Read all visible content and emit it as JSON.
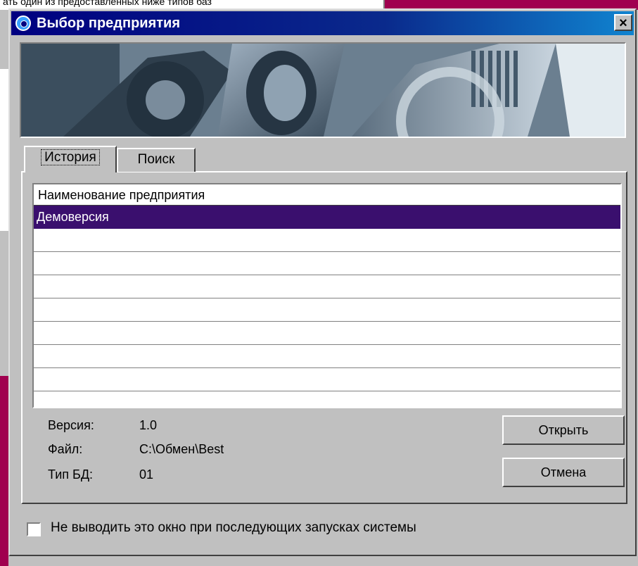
{
  "background": {
    "window_text": "ать один из предоставленных ниже типов баз"
  },
  "dialog": {
    "title": "Выбор предприятия",
    "close_label": "×"
  },
  "tabs": [
    {
      "label": "История",
      "active": true
    },
    {
      "label": "Поиск",
      "active": false
    }
  ],
  "list": {
    "header": "Наименование предприятия",
    "rows": [
      {
        "label": "Демоверсия",
        "selected": true
      },
      {
        "label": ""
      },
      {
        "label": ""
      },
      {
        "label": ""
      },
      {
        "label": ""
      },
      {
        "label": ""
      },
      {
        "label": ""
      },
      {
        "label": ""
      }
    ]
  },
  "info": {
    "version_label": "Версия:",
    "version_value": "1.0",
    "file_label": "Файл:",
    "file_value": "C:\\Обмен\\Best",
    "dbtype_label": "Тип БД:",
    "dbtype_value": "01"
  },
  "buttons": {
    "open": "Открыть",
    "cancel": "Отмена"
  },
  "checkbox": {
    "label": "Не выводить это окно при последующих запусках системы",
    "checked": false
  },
  "colors": {
    "titlebar": "#000080",
    "selection": "#3a0f6e",
    "background_window": "#a0004f"
  },
  "icons": {
    "title": "app-globe-icon",
    "close": "close-icon"
  }
}
